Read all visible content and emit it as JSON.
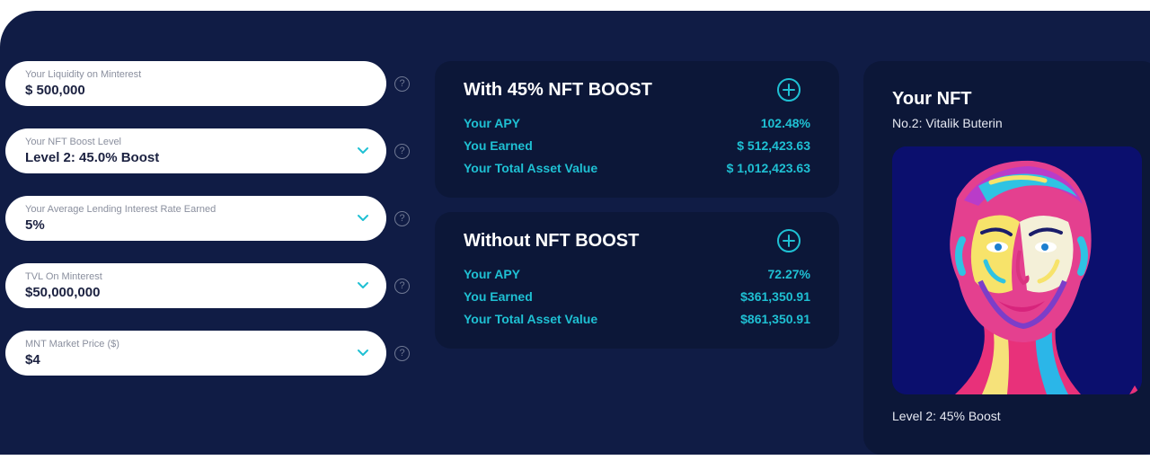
{
  "inputs": [
    {
      "label": "Your Liquidity on Minterest",
      "value": "$ 500,000",
      "dropdown": false
    },
    {
      "label": "Your NFT Boost Level",
      "value": "Level 2: 45.0% Boost",
      "dropdown": true
    },
    {
      "label": "Your Average Lending Interest Rate Earned",
      "value": "5%",
      "dropdown": true
    },
    {
      "label": "TVL On Minterest",
      "value": "$50,000,000",
      "dropdown": true
    },
    {
      "label": "MNT Market Price ($)",
      "value": "$4",
      "dropdown": true
    }
  ],
  "help_glyph": "?",
  "with_boost": {
    "title": "With 45% NFT BOOST",
    "rows": [
      {
        "label": "Your APY",
        "value": "102.48%"
      },
      {
        "label": "You Earned",
        "value": "$ 512,423.63"
      },
      {
        "label": "Your Total Asset Value",
        "value": "$ 1,012,423.63"
      }
    ]
  },
  "without_boost": {
    "title": "Without NFT BOOST",
    "rows": [
      {
        "label": "Your APY",
        "value": "72.27%"
      },
      {
        "label": "You Earned",
        "value": "$361,350.91"
      },
      {
        "label": "Your Total Asset Value",
        "value": "$861,350.91"
      }
    ]
  },
  "nft": {
    "title": "Your NFT",
    "name": "No.2: Vitalik Buterin",
    "level": "Level 2: 45% Boost"
  },
  "icons": {
    "dropdown": "chevron-down-icon",
    "help": "question-circle-icon",
    "expand": "plus-circle-icon"
  },
  "colors": {
    "background": "#101c45",
    "card": "#0c1738",
    "accent": "#1fc0d3",
    "field": "#ffffff",
    "nft_bg": "#0b0f6e"
  }
}
